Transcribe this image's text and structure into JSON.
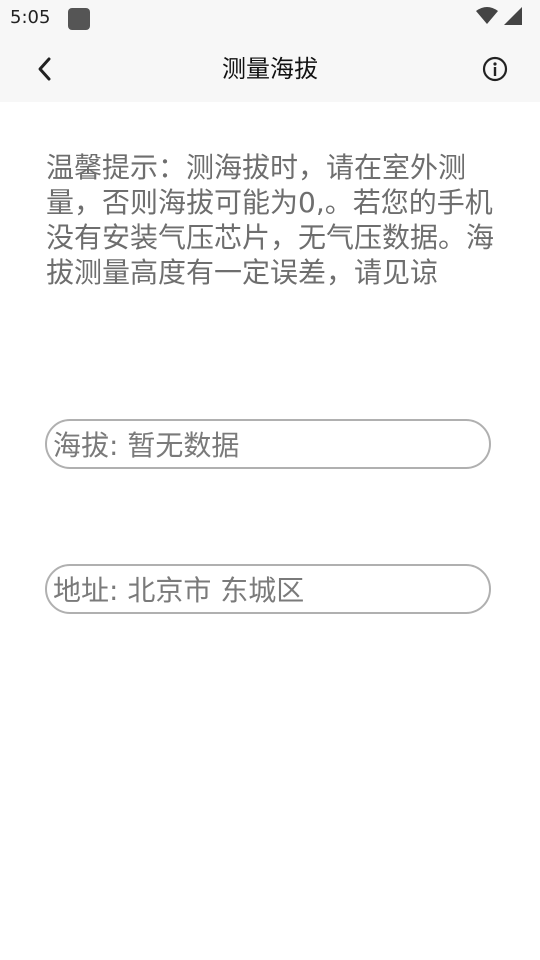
{
  "status_bar": {
    "time": "5:05"
  },
  "header": {
    "title": "测量海拔"
  },
  "main": {
    "tip": "温馨提示：测海拔时，请在室外测量，否则海拔可能为0,。若您的手机没有安装气压芯片，无气压数据。海拔测量高度有一定误差，请见谅",
    "altitude": "海拔: 暂无数据",
    "address": "地址: 北京市 东城区"
  }
}
